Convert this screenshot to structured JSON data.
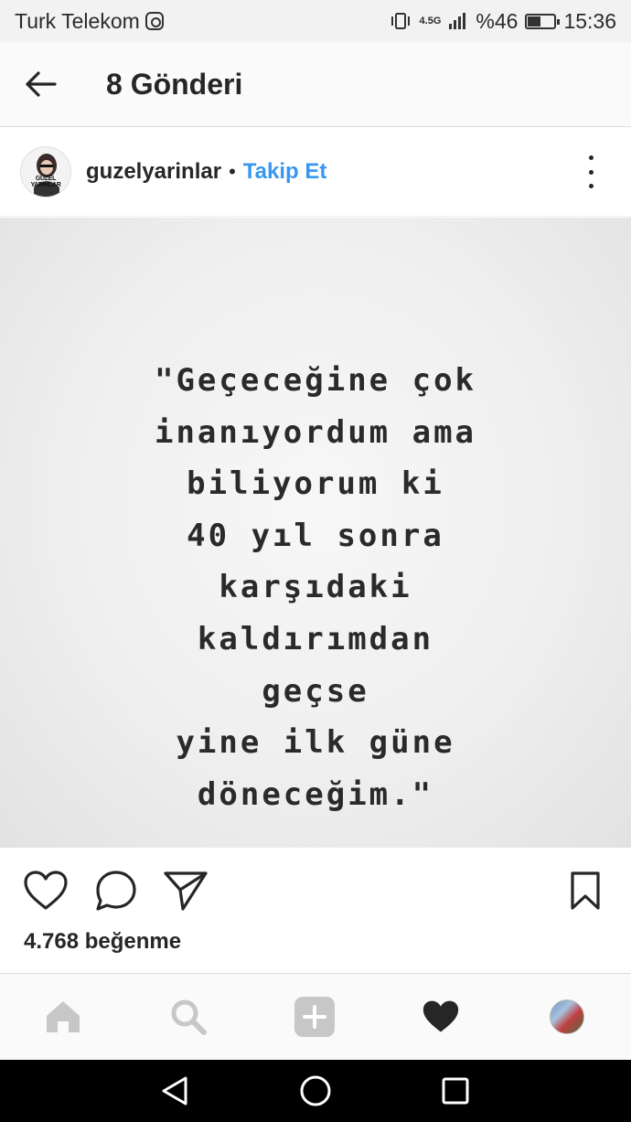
{
  "status_bar": {
    "carrier": "Turk Telekom",
    "network": "4.5G",
    "battery_percent": "%46",
    "battery_level": 0.46,
    "time": "15:36"
  },
  "header": {
    "title": "8 Gönderi"
  },
  "post": {
    "username": "guzelyarinlar",
    "separator": "•",
    "follow_label": "Takip Et",
    "avatar_text": "GUZEL YARINLAR",
    "quote_lines": [
      "\"Geçeceğine çok",
      "inanıyordum ama",
      "biliyorum ki",
      "40 yıl sonra",
      "karşıdaki",
      "kaldırımdan",
      "geçse",
      "yine ilk güne",
      "döneceğim.\""
    ],
    "likes": "4.768 beğenme"
  },
  "icons": {
    "back": "arrow-left-icon",
    "more": "more-vertical-icon",
    "like": "heart-outline-icon",
    "comment": "comment-bubble-icon",
    "share": "paper-plane-icon",
    "save": "bookmark-icon",
    "home": "home-icon",
    "search": "search-icon",
    "add": "plus-square-icon",
    "activity": "heart-filled-icon"
  },
  "colors": {
    "link_blue": "#3897f0",
    "text": "#262626",
    "nav_grey": "#c7c7c7"
  }
}
